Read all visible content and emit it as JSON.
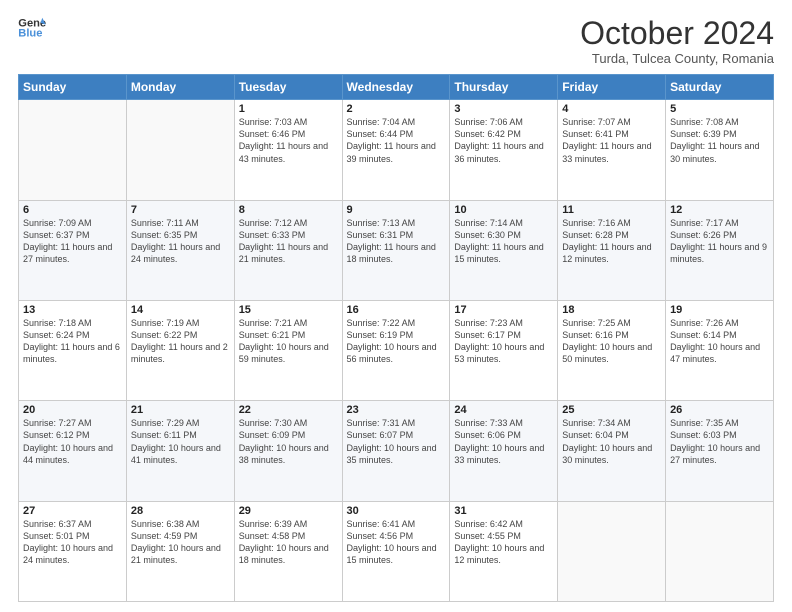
{
  "header": {
    "logo_line1": "General",
    "logo_line2": "Blue",
    "month": "October 2024",
    "location": "Turda, Tulcea County, Romania"
  },
  "weekdays": [
    "Sunday",
    "Monday",
    "Tuesday",
    "Wednesday",
    "Thursday",
    "Friday",
    "Saturday"
  ],
  "weeks": [
    [
      {
        "day": "",
        "info": ""
      },
      {
        "day": "",
        "info": ""
      },
      {
        "day": "1",
        "info": "Sunrise: 7:03 AM\nSunset: 6:46 PM\nDaylight: 11 hours and 43 minutes."
      },
      {
        "day": "2",
        "info": "Sunrise: 7:04 AM\nSunset: 6:44 PM\nDaylight: 11 hours and 39 minutes."
      },
      {
        "day": "3",
        "info": "Sunrise: 7:06 AM\nSunset: 6:42 PM\nDaylight: 11 hours and 36 minutes."
      },
      {
        "day": "4",
        "info": "Sunrise: 7:07 AM\nSunset: 6:41 PM\nDaylight: 11 hours and 33 minutes."
      },
      {
        "day": "5",
        "info": "Sunrise: 7:08 AM\nSunset: 6:39 PM\nDaylight: 11 hours and 30 minutes."
      }
    ],
    [
      {
        "day": "6",
        "info": "Sunrise: 7:09 AM\nSunset: 6:37 PM\nDaylight: 11 hours and 27 minutes."
      },
      {
        "day": "7",
        "info": "Sunrise: 7:11 AM\nSunset: 6:35 PM\nDaylight: 11 hours and 24 minutes."
      },
      {
        "day": "8",
        "info": "Sunrise: 7:12 AM\nSunset: 6:33 PM\nDaylight: 11 hours and 21 minutes."
      },
      {
        "day": "9",
        "info": "Sunrise: 7:13 AM\nSunset: 6:31 PM\nDaylight: 11 hours and 18 minutes."
      },
      {
        "day": "10",
        "info": "Sunrise: 7:14 AM\nSunset: 6:30 PM\nDaylight: 11 hours and 15 minutes."
      },
      {
        "day": "11",
        "info": "Sunrise: 7:16 AM\nSunset: 6:28 PM\nDaylight: 11 hours and 12 minutes."
      },
      {
        "day": "12",
        "info": "Sunrise: 7:17 AM\nSunset: 6:26 PM\nDaylight: 11 hours and 9 minutes."
      }
    ],
    [
      {
        "day": "13",
        "info": "Sunrise: 7:18 AM\nSunset: 6:24 PM\nDaylight: 11 hours and 6 minutes."
      },
      {
        "day": "14",
        "info": "Sunrise: 7:19 AM\nSunset: 6:22 PM\nDaylight: 11 hours and 2 minutes."
      },
      {
        "day": "15",
        "info": "Sunrise: 7:21 AM\nSunset: 6:21 PM\nDaylight: 10 hours and 59 minutes."
      },
      {
        "day": "16",
        "info": "Sunrise: 7:22 AM\nSunset: 6:19 PM\nDaylight: 10 hours and 56 minutes."
      },
      {
        "day": "17",
        "info": "Sunrise: 7:23 AM\nSunset: 6:17 PM\nDaylight: 10 hours and 53 minutes."
      },
      {
        "day": "18",
        "info": "Sunrise: 7:25 AM\nSunset: 6:16 PM\nDaylight: 10 hours and 50 minutes."
      },
      {
        "day": "19",
        "info": "Sunrise: 7:26 AM\nSunset: 6:14 PM\nDaylight: 10 hours and 47 minutes."
      }
    ],
    [
      {
        "day": "20",
        "info": "Sunrise: 7:27 AM\nSunset: 6:12 PM\nDaylight: 10 hours and 44 minutes."
      },
      {
        "day": "21",
        "info": "Sunrise: 7:29 AM\nSunset: 6:11 PM\nDaylight: 10 hours and 41 minutes."
      },
      {
        "day": "22",
        "info": "Sunrise: 7:30 AM\nSunset: 6:09 PM\nDaylight: 10 hours and 38 minutes."
      },
      {
        "day": "23",
        "info": "Sunrise: 7:31 AM\nSunset: 6:07 PM\nDaylight: 10 hours and 35 minutes."
      },
      {
        "day": "24",
        "info": "Sunrise: 7:33 AM\nSunset: 6:06 PM\nDaylight: 10 hours and 33 minutes."
      },
      {
        "day": "25",
        "info": "Sunrise: 7:34 AM\nSunset: 6:04 PM\nDaylight: 10 hours and 30 minutes."
      },
      {
        "day": "26",
        "info": "Sunrise: 7:35 AM\nSunset: 6:03 PM\nDaylight: 10 hours and 27 minutes."
      }
    ],
    [
      {
        "day": "27",
        "info": "Sunrise: 6:37 AM\nSunset: 5:01 PM\nDaylight: 10 hours and 24 minutes."
      },
      {
        "day": "28",
        "info": "Sunrise: 6:38 AM\nSunset: 4:59 PM\nDaylight: 10 hours and 21 minutes."
      },
      {
        "day": "29",
        "info": "Sunrise: 6:39 AM\nSunset: 4:58 PM\nDaylight: 10 hours and 18 minutes."
      },
      {
        "day": "30",
        "info": "Sunrise: 6:41 AM\nSunset: 4:56 PM\nDaylight: 10 hours and 15 minutes."
      },
      {
        "day": "31",
        "info": "Sunrise: 6:42 AM\nSunset: 4:55 PM\nDaylight: 10 hours and 12 minutes."
      },
      {
        "day": "",
        "info": ""
      },
      {
        "day": "",
        "info": ""
      }
    ]
  ]
}
